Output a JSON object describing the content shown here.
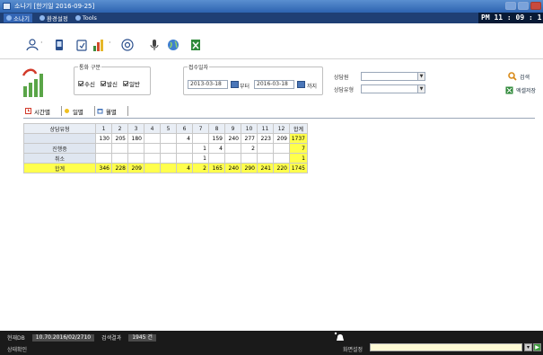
{
  "window": {
    "title": "소나기 [한기일 2016-09-25]"
  },
  "menu": {
    "items": [
      {
        "label": "소나기"
      },
      {
        "label": "환경설정"
      },
      {
        "label": "Tools"
      }
    ],
    "clock": "PM  11 : 09 : 1"
  },
  "filter": {
    "type_group": {
      "legend": "통화 구분",
      "options": [
        {
          "label": "수신",
          "checked": true
        },
        {
          "label": "발신",
          "checked": true
        },
        {
          "label": "일반",
          "checked": true
        }
      ]
    },
    "date": {
      "legend": "접수일자",
      "from": "2013-03-18",
      "from_suffix": "부터",
      "to": "2016-03-18",
      "to_suffix": "까지"
    },
    "agent_label": "상담원",
    "consult_type_label": "상담유형",
    "search_label": "검색",
    "excel_label": "엑셀저장"
  },
  "tabs": [
    {
      "label": "시간별"
    },
    {
      "label": "일별"
    },
    {
      "label": "월별"
    }
  ],
  "table": {
    "corner": "상담유형",
    "columns": [
      "1",
      "2",
      "3",
      "4",
      "5",
      "6",
      "7",
      "8",
      "9",
      "10",
      "11",
      "12",
      "합계"
    ],
    "rows": [
      {
        "label": "",
        "cells": [
          "130",
          "205",
          "180",
          "",
          "",
          "4",
          "",
          "159",
          "240",
          "277",
          "223",
          "209",
          "1737"
        ]
      },
      {
        "label": "진행중",
        "cells": [
          "",
          "",
          "",
          "",
          "",
          "",
          "1",
          "4",
          "",
          "2",
          "",
          "",
          "7"
        ]
      },
      {
        "label": "취소",
        "cells": [
          "",
          "",
          "",
          "",
          "",
          "",
          "1",
          "",
          "",
          "",
          "",
          "",
          "1"
        ]
      },
      {
        "label": "합계",
        "cells": [
          "346",
          "228",
          "209",
          "",
          "",
          "4",
          "2",
          "165",
          "240",
          "290",
          "241",
          "220",
          "1745"
        ]
      }
    ]
  },
  "statusbar": {
    "db_label": "현재DB",
    "db_value": "10.70.2016/02/2710",
    "count_label": "검색결과",
    "count_value": "1945 건",
    "login_label": "상태확인",
    "settings_label": "화면설정"
  }
}
